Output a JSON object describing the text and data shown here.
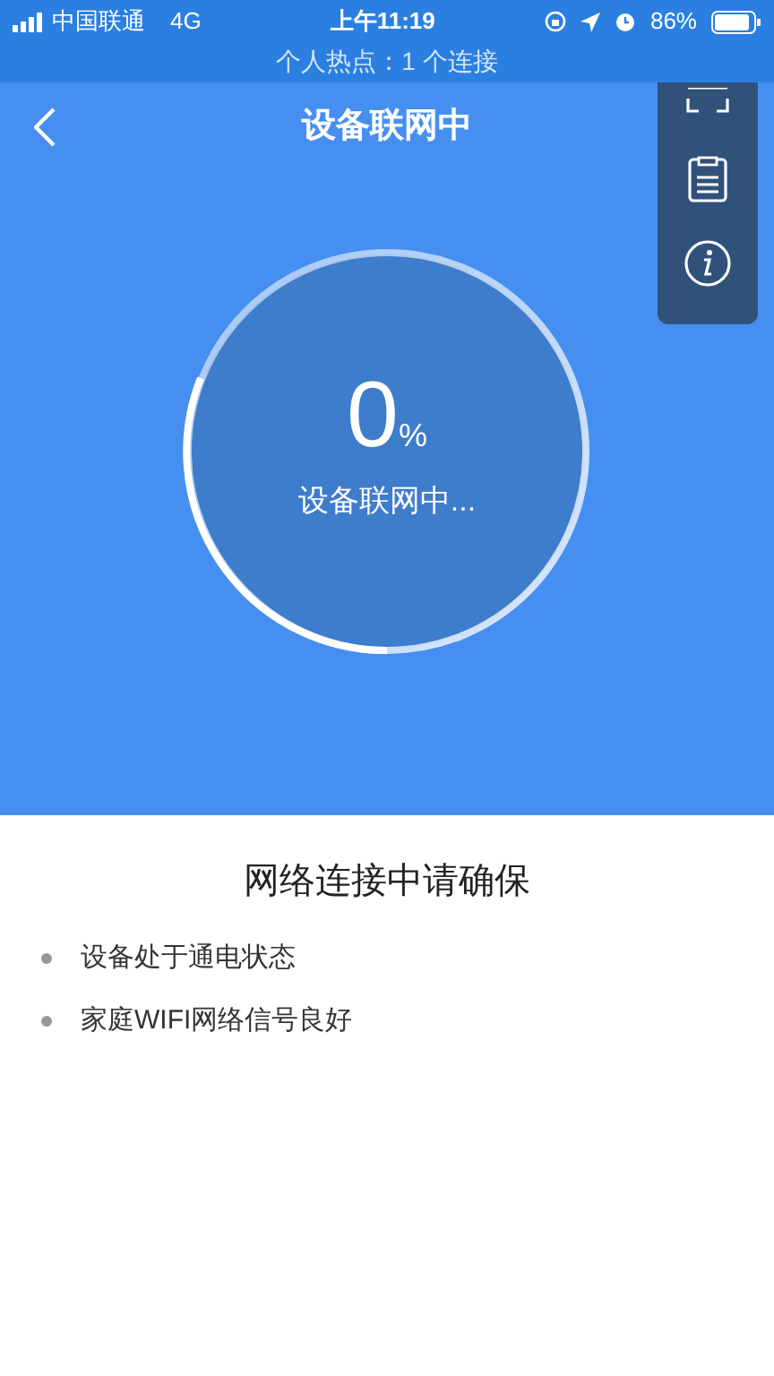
{
  "status_bar": {
    "carrier": "中国联通",
    "network": "4G",
    "time": "上午11:19",
    "battery": "86%",
    "hotspot": "个人热点：1 个连接"
  },
  "header": {
    "title": "设备联网中"
  },
  "progress": {
    "percent": "0",
    "unit": "%",
    "caption": "设备联网中..."
  },
  "tips": {
    "title": "网络连接中请确保",
    "items": [
      "设备处于通电状态",
      "家庭WIFI网络信号良好"
    ]
  }
}
